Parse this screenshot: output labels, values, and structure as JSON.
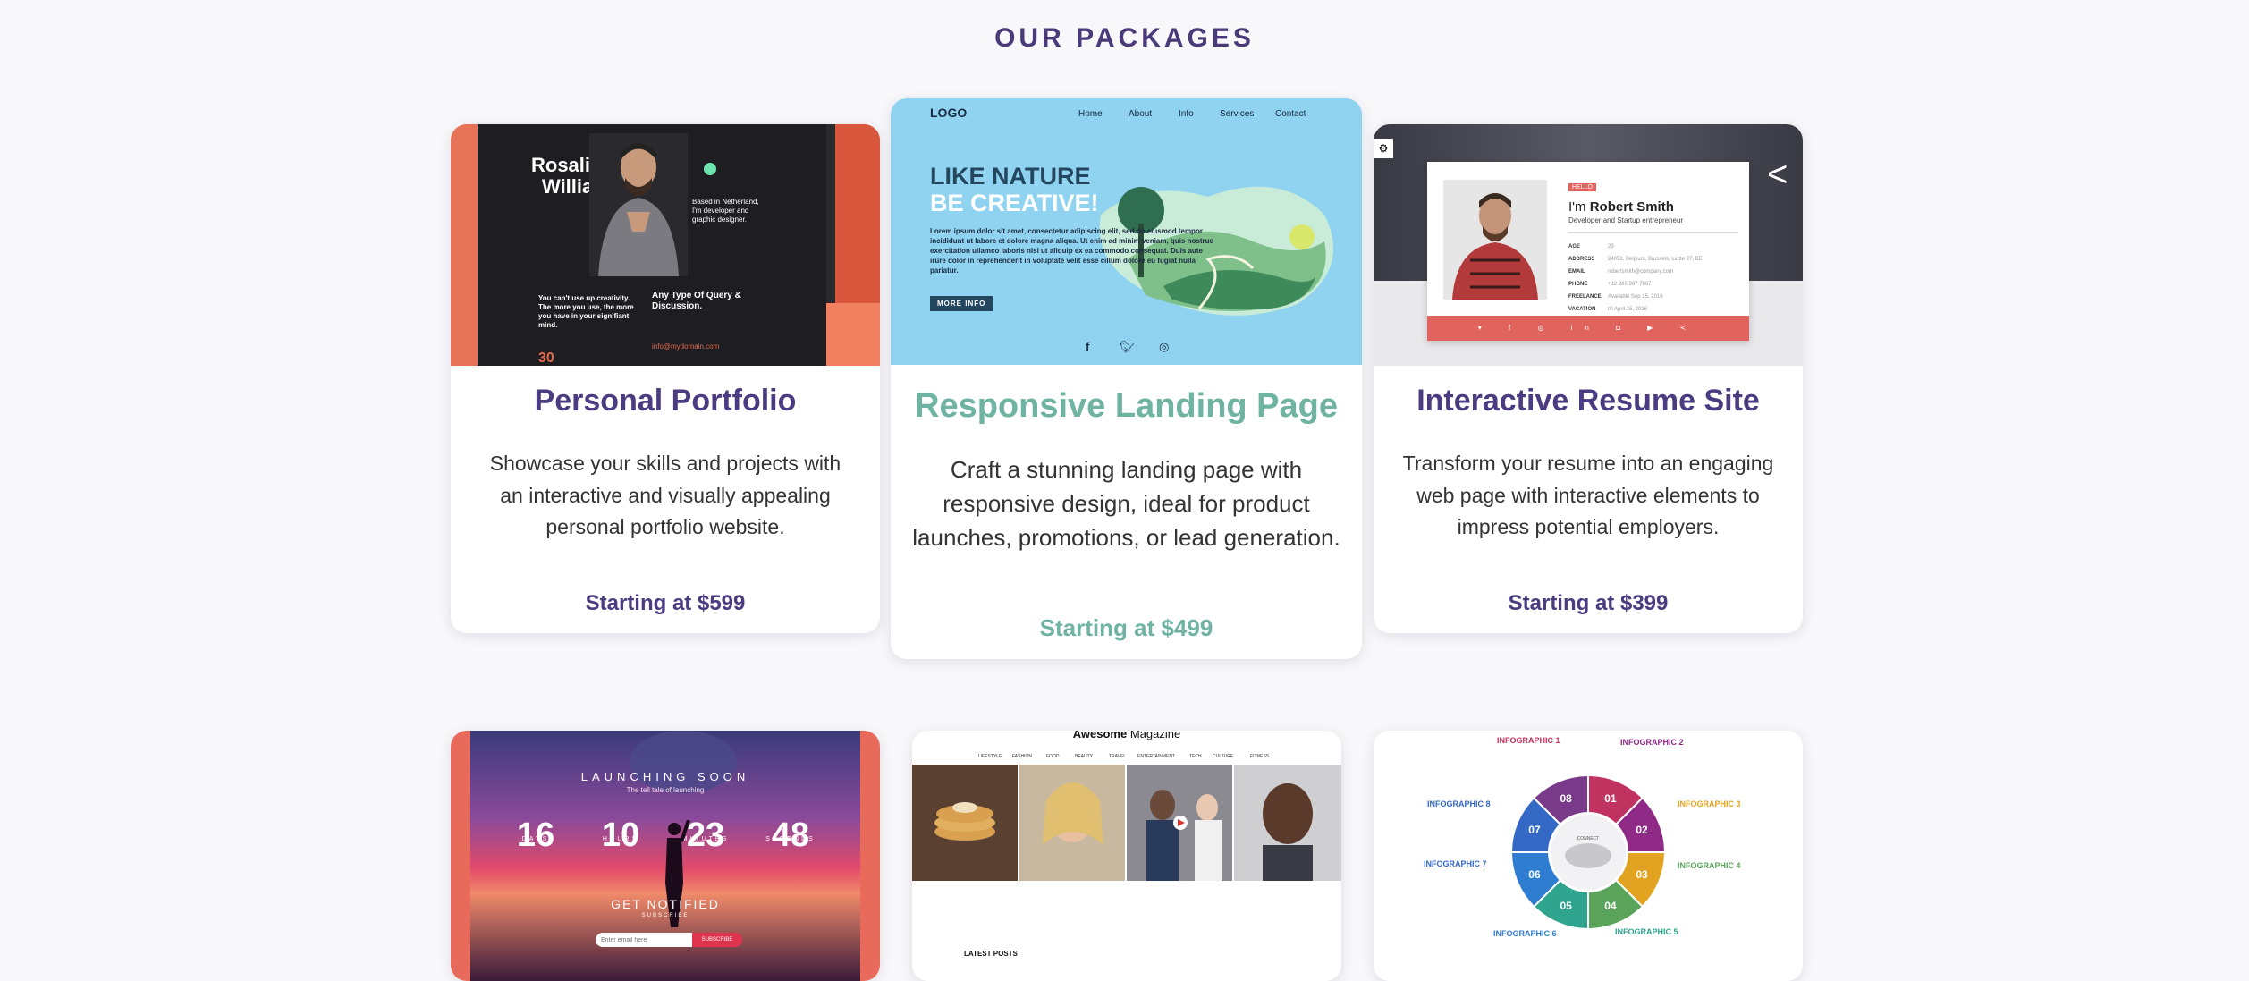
{
  "section": {
    "title": "OUR PACKAGES"
  },
  "packages": [
    {
      "title": "Personal Portfolio",
      "description": "Showcase your skills and projects with an interactive and visually appealing personal portfolio website.",
      "price": "Starting at $599",
      "thumb": {
        "name_line1": "Rosalina",
        "name_line2": "William",
        "bio": "Based in Netherland, I'm developer and graphic designer.",
        "tagline": "You can't use up creativity. The more you use, the more you have in your signifiant mind.",
        "query": "Any Type Of Query & Discussion.",
        "number": "30",
        "email": "info@mydomain.com"
      }
    },
    {
      "title": "Responsive Landing Page",
      "description": "Craft a stunning landing page with responsive design, ideal for product launches, promotions, or lead generation.",
      "price": "Starting at $499",
      "thumb": {
        "logo": "LOGO",
        "nav": [
          "Home",
          "About",
          "Info",
          "Services",
          "Contact"
        ],
        "headline1": "LIKE NATURE",
        "headline2": "BE CREATIVE!",
        "body": "Lorem ipsum dolor sit amet, consectetur adipiscing elit, sed do eiusmod tempor incididunt ut labore et dolore magna aliqua. Ut enim ad minim veniam, quis nostrud exercitation ullamco laboris nisi ut aliquip ex ea commodo consequat. Duis aute irure dolor in reprehenderit in voluptate velit esse cillum dolore eu fugiat nulla pariatur.",
        "cta": "MORE INFO",
        "social": [
          "f",
          "t",
          "◎"
        ]
      }
    },
    {
      "title": "Interactive Resume Site",
      "description": "Transform your resume into an engaging web page with interactive elements to impress potential employers.",
      "price": "Starting at $399",
      "thumb": {
        "badge": "HELLO",
        "greeting": "I'm",
        "name": "Robert Smith",
        "role": "Developer and Startup entrepreneur",
        "fields": [
          "AGE",
          "ADDRESS",
          "EMAIL",
          "PHONE",
          "FREELANCE",
          "VACATION"
        ],
        "values": [
          "29",
          "24058, Belgium, Brussels, Liutte 27, BE",
          "robertsmith@company.com",
          "+12 986 987 7867",
          "Available Sep 15, 2016",
          "till April 15, 2016"
        ]
      }
    },
    {
      "thumb": {
        "heading": "LAUNCHING SOON",
        "sub": "The tell tale of launching",
        "count": [
          "16",
          "10",
          "23",
          "48"
        ],
        "units": [
          "DAYS",
          "HOURS",
          "MINUTES",
          "SECONDS"
        ],
        "notify": "GET NOTIFIED",
        "subscribe_label": "SUBSCRIBE",
        "email_placeholder": "Enter email here",
        "button": "SUBSCRIBE"
      }
    },
    {
      "thumb": {
        "brand_bold": "Awesome",
        "brand_rest": "Magazine",
        "nav": [
          "LIFESTYLE",
          "FASHION",
          "FOOD",
          "BEAUTY",
          "TRAVEL",
          "ENTERTAINMENT",
          "TECH",
          "CULTURE",
          "FITNESS"
        ],
        "latest": "LATEST POSTS"
      }
    },
    {
      "thumb": {
        "labels": [
          "INFOGRAPHIC 1",
          "INFOGRAPHIC 2",
          "INFOGRAPHIC 3",
          "INFOGRAPHIC 4",
          "INFOGRAPHIC 5",
          "INFOGRAPHIC 6",
          "INFOGRAPHIC 7",
          "INFOGRAPHIC 8"
        ],
        "numbers": [
          "01",
          "02",
          "03",
          "04",
          "05",
          "06",
          "07",
          "08"
        ],
        "center": "CONNECT",
        "colors": [
          "#c0325f",
          "#8f2a86",
          "#e1a320",
          "#5aa35a",
          "#2fa48f",
          "#2e7dd1",
          "#3468c5",
          "#7a3a8a"
        ]
      }
    }
  ]
}
